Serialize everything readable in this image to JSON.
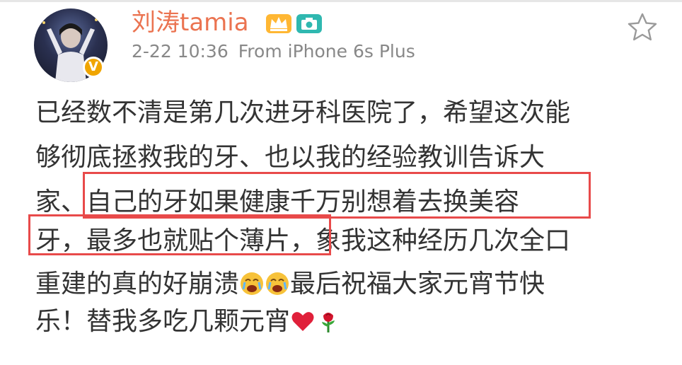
{
  "post": {
    "author": {
      "name": "刘涛tamia",
      "verified": true,
      "badges": [
        "crown-badge-icon",
        "camera-badge-icon"
      ]
    },
    "time": "2-22 10:36",
    "source": "From iPhone 6s Plus",
    "text_lines": [
      "已经数不清是第几次进牙科医院了，希望这次能",
      "够彻底拯救我的牙、也以我的经验教训告诉大",
      "家、自己的牙如果健康千万别想着去换美容",
      "牙，最多也就贴个薄片，象我这种经历几次全口",
      "重建的真的好崩溃",
      "最后祝福大家元宵节快",
      "乐！替我多吃几颗元宵"
    ],
    "emojis": [
      "crying-emoji",
      "crying-emoji",
      "red-heart-emoji",
      "rose-emoji"
    ],
    "highlight_color": "#e84a4a"
  },
  "colors": {
    "name": "#eb7350",
    "meta": "#888888",
    "text": "#333333",
    "verified": "#f0a500"
  }
}
